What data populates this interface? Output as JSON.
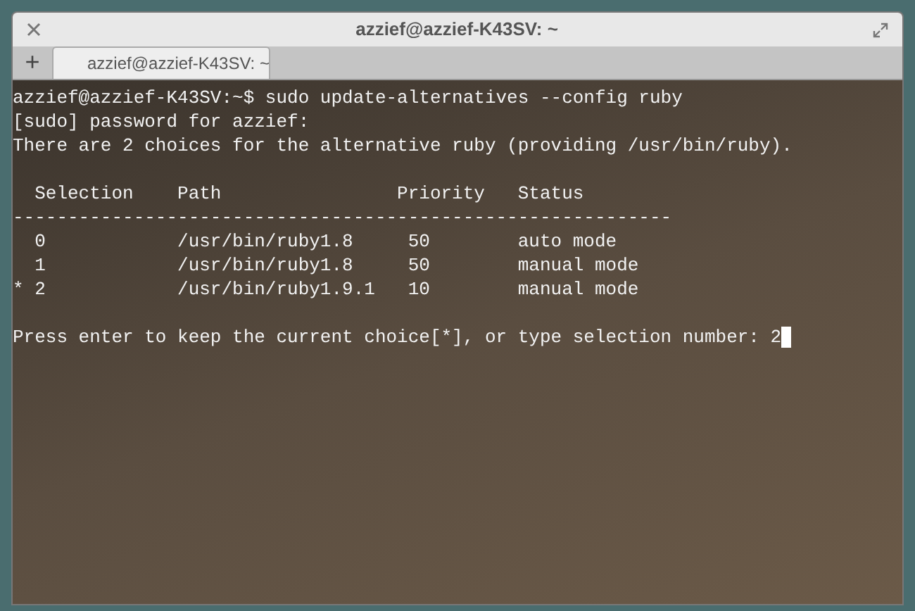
{
  "window": {
    "title": "azzief@azzief-K43SV: ~"
  },
  "tabs": [
    {
      "label": "azzief@azzief-K43SV: ~",
      "selected": true
    }
  ],
  "new_tab": {
    "label": "+"
  },
  "terminal": {
    "lines": [
      {
        "kind": "text",
        "text": "azzief@azzief-K43SV:~$ sudo update-alternatives --config ruby",
        "cursor": false
      },
      {
        "kind": "text",
        "text": "[sudo] password for azzief:",
        "cursor": false
      },
      {
        "kind": "text",
        "text": "There are 2 choices for the alternative ruby (providing /usr/bin/ruby).",
        "cursor": false
      },
      {
        "kind": "blank"
      },
      {
        "kind": "text",
        "text": "  Selection    Path                Priority   Status",
        "cursor": false
      },
      {
        "kind": "text",
        "text": "------------------------------------------------------------",
        "cursor": false
      },
      {
        "kind": "text",
        "text": "  0            /usr/bin/ruby1.8     50        auto mode",
        "cursor": false
      },
      {
        "kind": "text",
        "text": "  1            /usr/bin/ruby1.8     50        manual mode",
        "cursor": false
      },
      {
        "kind": "text",
        "text": "* 2            /usr/bin/ruby1.9.1   10        manual mode",
        "cursor": false
      },
      {
        "kind": "blank"
      },
      {
        "kind": "text",
        "text": "Press enter to keep the current choice[*], or type selection number: 2",
        "cursor": true
      }
    ]
  }
}
